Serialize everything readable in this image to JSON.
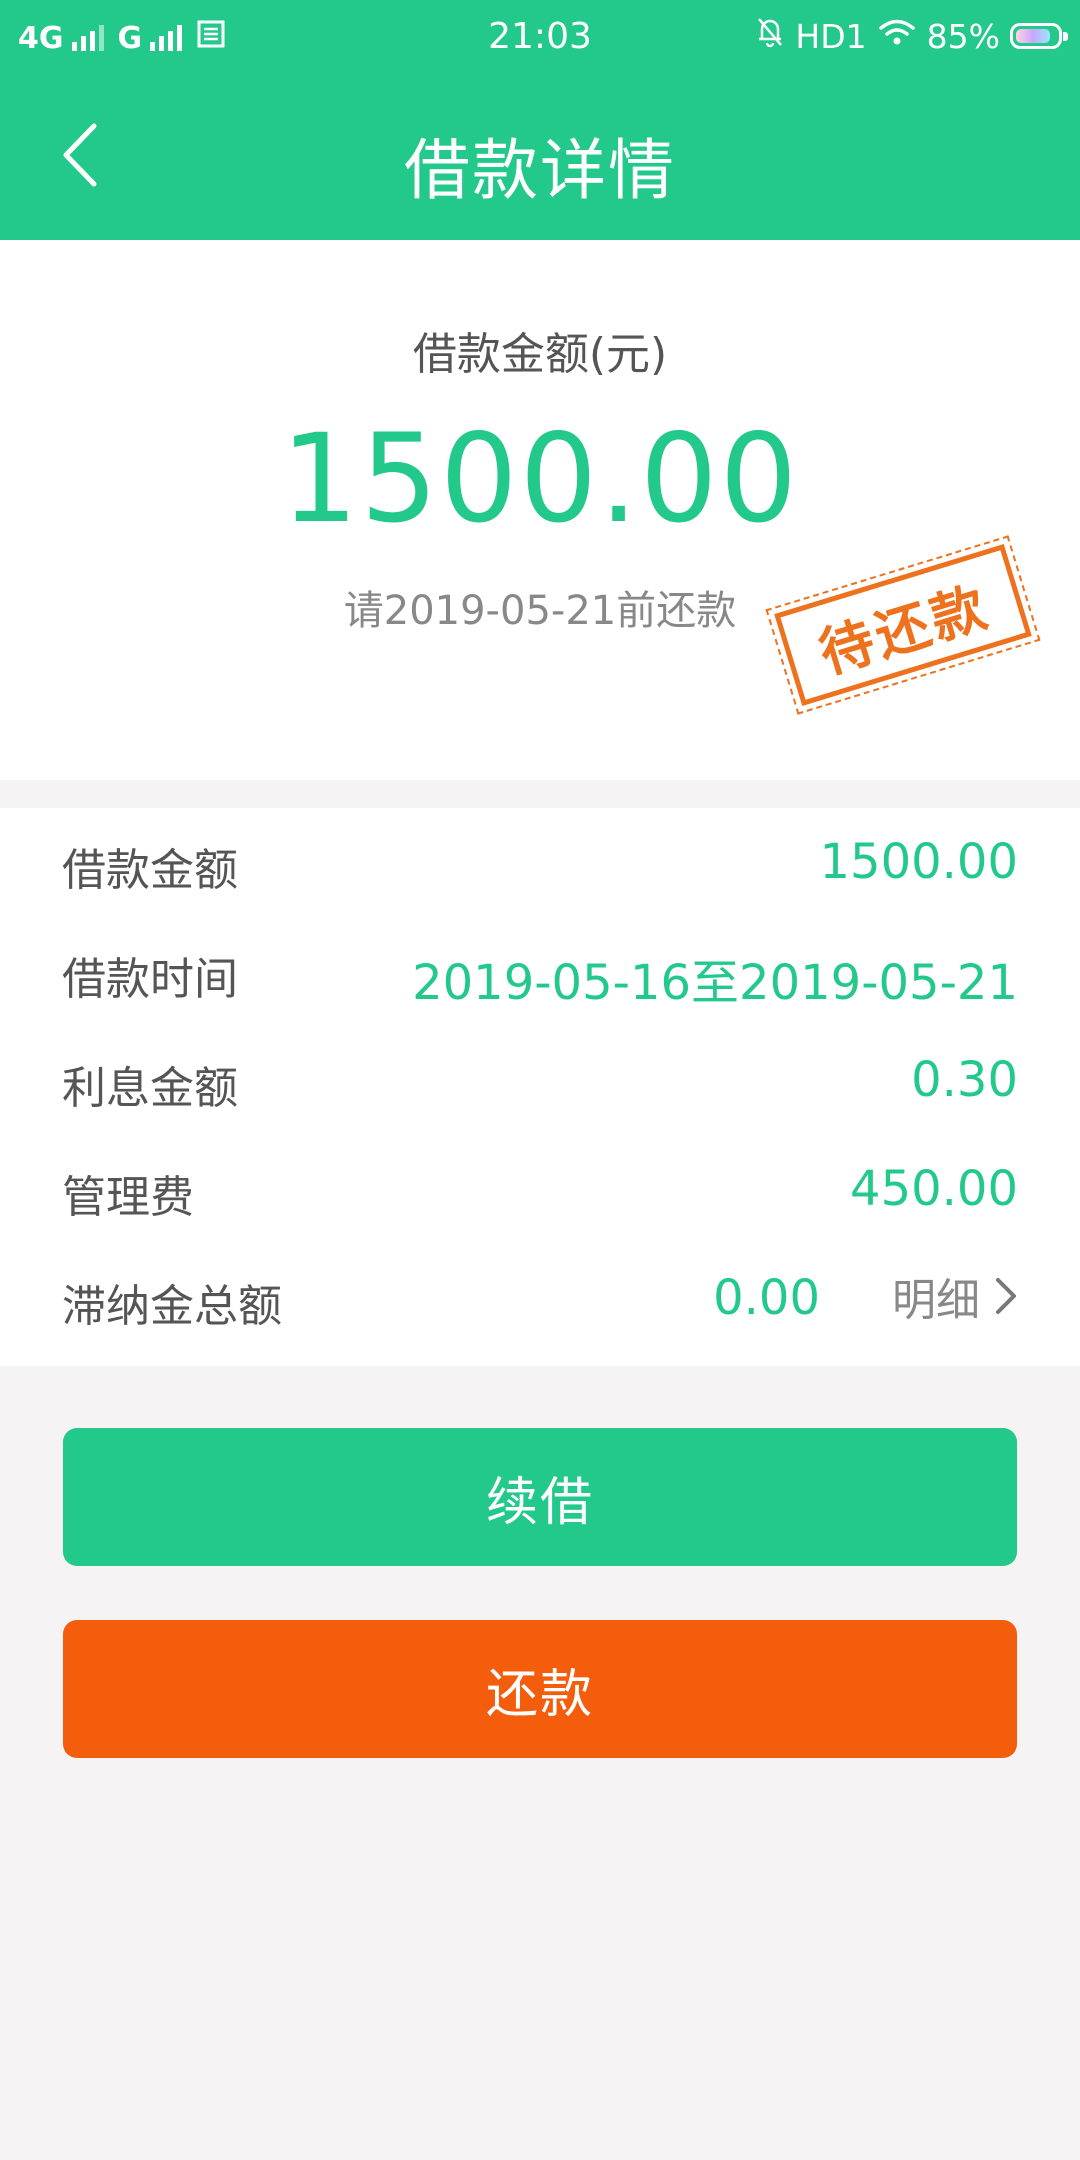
{
  "status_bar": {
    "network_1": "4G",
    "network_2": "G",
    "time": "21:03",
    "hd": "HD1",
    "battery": "85%",
    "battery_level": 0.85
  },
  "title_bar": {
    "back_icon": "chevron-left-icon",
    "title": "借款详情"
  },
  "summary": {
    "label": "借款金额(元)",
    "amount": "1500.00",
    "due_text": "请2019-05-21前还款",
    "stamp_text": "待还款",
    "stamp_color": "#ee6a12"
  },
  "details": {
    "rows": [
      {
        "label": "借款金额",
        "value": "1500.00"
      },
      {
        "label": "借款时间",
        "value": "2019-05-16至2019-05-21"
      },
      {
        "label": "利息金额",
        "value": "0.30"
      },
      {
        "label": "管理费",
        "value": "450.00"
      },
      {
        "label": "滞纳金总额",
        "value": "0.00",
        "link": "明细"
      }
    ]
  },
  "buttons": {
    "renew": "续借",
    "repay": "还款"
  },
  "colors": {
    "brand_green": "#23c98a",
    "repay_orange": "#f45d0b",
    "background": "#f5f3f3"
  }
}
